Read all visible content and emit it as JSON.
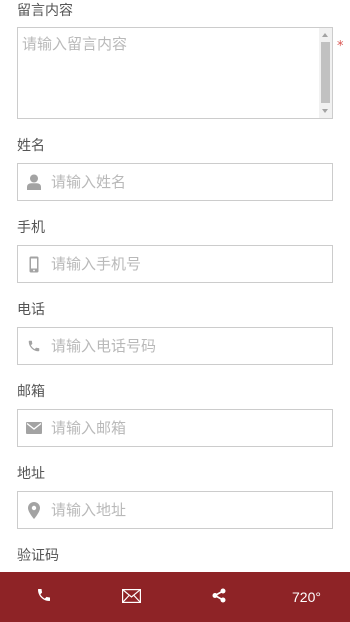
{
  "form": {
    "message": {
      "label": "留言内容",
      "placeholder": "请输入留言内容",
      "required_mark": "*"
    },
    "fields": [
      {
        "label": "姓名",
        "placeholder": "请输入姓名",
        "icon": "user-icon"
      },
      {
        "label": "手机",
        "placeholder": "请输入手机号",
        "icon": "mobile-icon"
      },
      {
        "label": "电话",
        "placeholder": "请输入电话号码",
        "icon": "phone-icon"
      },
      {
        "label": "邮箱",
        "placeholder": "请输入邮箱",
        "icon": "envelope-icon"
      },
      {
        "label": "地址",
        "placeholder": "请输入地址",
        "icon": "map-marker-icon"
      }
    ],
    "captcha": {
      "label": "验证码"
    }
  },
  "bottom_bar": {
    "items": [
      {
        "icon": "phone-icon"
      },
      {
        "icon": "envelope-icon"
      },
      {
        "icon": "share-icon"
      },
      {
        "label": "720°"
      }
    ]
  },
  "colors": {
    "bottom_bar_bg": "#8e2326",
    "required_mark": "#d9534f",
    "icon_gray": "#a3a3a3",
    "border": "#cccccc"
  }
}
